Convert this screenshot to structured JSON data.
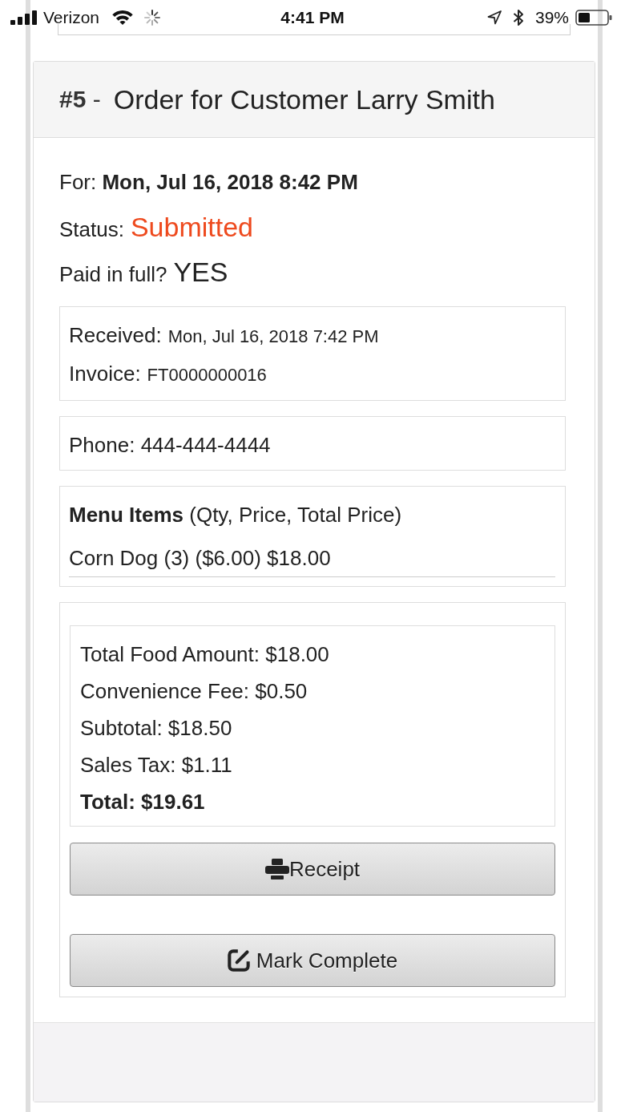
{
  "status_bar": {
    "carrier": "Verizon",
    "time": "4:41 PM",
    "battery": "39%"
  },
  "order": {
    "number": "**#5** -",
    "title": "Order for Customer Larry Smith"
  },
  "details": {
    "for": "For: **Mon, Jul 16, 2018 8:42 PM**",
    "status_label": "Status:",
    "status_value": "Submitted",
    "paid_label": "Paid in full?",
    "paid_value": "YES"
  },
  "info_boxes": [
    {
      "kind": "pairs",
      "rows": [
        {
          "label": "Received:",
          "value": "Mon, Jul 16, 2018 7:42 PM"
        },
        {
          "label": "Invoice:",
          "value": "FT0000000016"
        }
      ]
    },
    {
      "kind": "text",
      "text": "Phone: 444-444-4444"
    }
  ],
  "menu": {
    "heading": "**Menu Items** (Qty, Price, Total Price)",
    "items": [
      "Corn Dog (3) ($6.00) $18.00"
    ]
  },
  "totals": [
    {
      "kind": "line",
      "text": "Total Food Amount: $18.00"
    },
    {
      "kind": "line",
      "text": "Convenience Fee: $0.50"
    },
    {
      "kind": "line",
      "text": "Subtotal: $18.50"
    },
    {
      "kind": "line",
      "text": "Sales Tax: $1.11"
    },
    {
      "kind": "grand",
      "text": "Total: $19.61"
    }
  ],
  "buttons": [
    {
      "kind": "print",
      "label": "Receipt"
    },
    {
      "kind": "edit",
      "label": "Mark Complete"
    }
  ]
}
